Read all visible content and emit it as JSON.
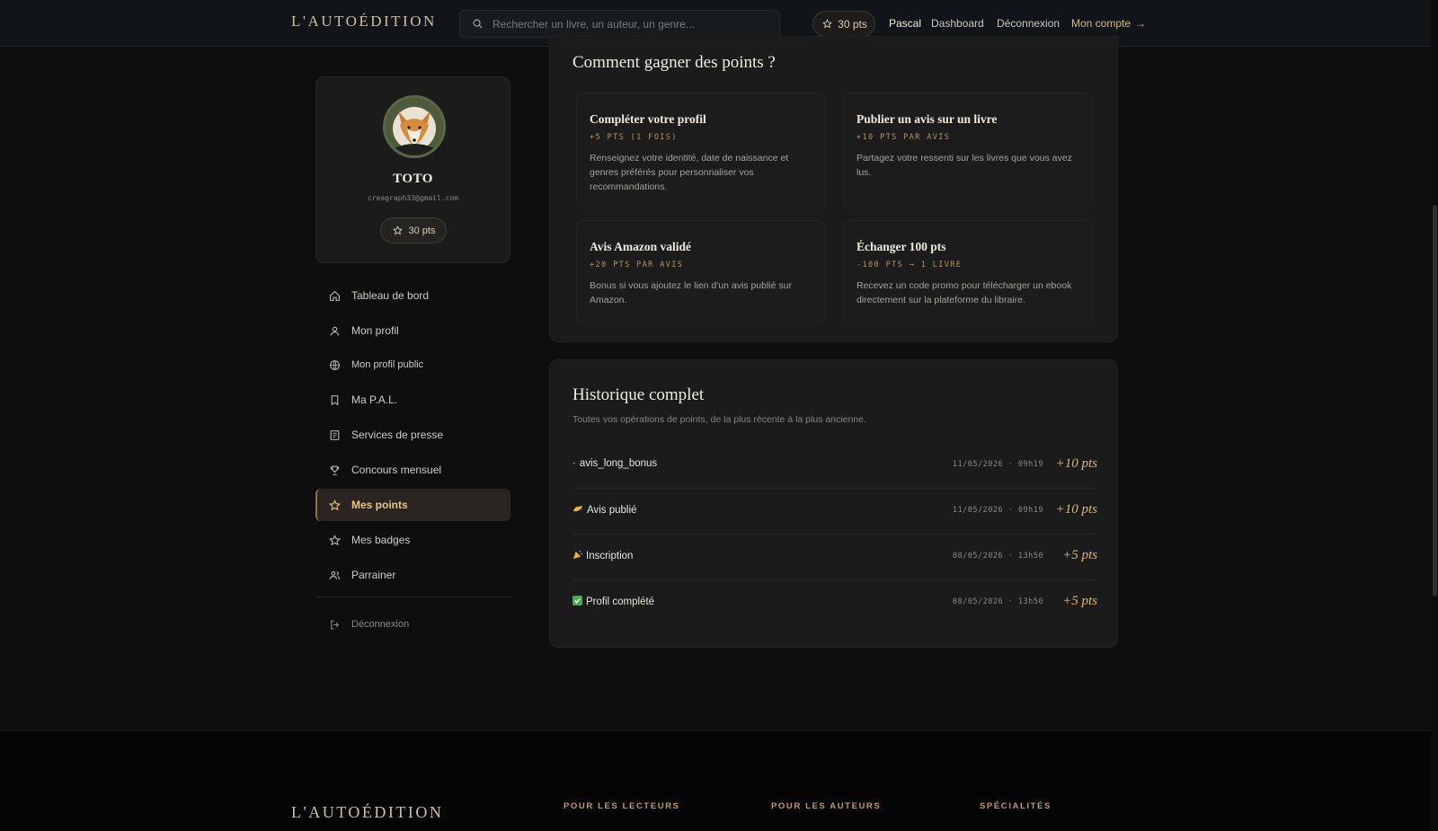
{
  "header": {
    "brand": "L'AUTOÉDITION",
    "search_placeholder": "Rechercher un livre, un auteur, un genre...",
    "points": "30 pts",
    "user": "Pascal",
    "dashboard": "Dashboard",
    "logout": "Déconnexion",
    "account": "Mon compte"
  },
  "profile": {
    "name": "TOTO",
    "email": "creagraph33@gmail.com",
    "points": "30 pts"
  },
  "sidebar": {
    "items": [
      {
        "label": "Tableau de bord",
        "icon": "home-icon"
      },
      {
        "label": "Mon profil",
        "icon": "user-icon"
      },
      {
        "label": "Mon profil public",
        "icon": "globe-icon"
      },
      {
        "label": "Ma P.A.L.",
        "icon": "bookmark-icon"
      },
      {
        "label": "Services de presse",
        "icon": "newspaper-icon"
      },
      {
        "label": "Concours mensuel",
        "icon": "trophy-icon"
      },
      {
        "label": "Mes points",
        "icon": "star-icon",
        "active": true
      },
      {
        "label": "Mes badges",
        "icon": "star-icon"
      },
      {
        "label": "Parrainer",
        "icon": "users-icon"
      }
    ],
    "logout": "Déconnexion"
  },
  "earn": {
    "title": "Comment gagner des points ?",
    "cards": [
      {
        "title": "Compléter votre profil",
        "tag": "+5 PTS (1 FOIS)",
        "desc": "Renseignez votre identité, date de naissance et genres préférés pour personnaliser vos recommandations."
      },
      {
        "title": "Publier un avis sur un livre",
        "tag": "+10 PTS PAR AVIS",
        "desc": "Partagez votre ressenti sur les livres que vous avez lus."
      },
      {
        "title": "Avis Amazon validé",
        "tag": "+20 PTS PAR AVIS",
        "desc": "Bonus si vous ajoutez le lien d'un avis publié sur Amazon."
      },
      {
        "title": "Échanger 100 pts",
        "tag": "-100 PTS → 1 LIVRE",
        "desc": "Recevez un code promo pour télécharger un ebook directement sur la plateforme du libraire."
      }
    ]
  },
  "history": {
    "title": "Historique complet",
    "subtitle": "Toutes vos opérations de points, de la plus récente à la plus ancienne.",
    "rows": [
      {
        "prefix": "·",
        "label": "avis_long_bonus",
        "date": "11/05/2026 · 09h19",
        "points": "+10 pts"
      },
      {
        "prefix": "",
        "label": "Avis publié",
        "date": "11/05/2026 · 09h19",
        "points": "+10 pts",
        "emoji": "writing-hand-icon"
      },
      {
        "prefix": "",
        "label": "Inscription",
        "date": "08/05/2026 · 13h50",
        "points": "+5 pts",
        "emoji": "party-popper-icon"
      },
      {
        "prefix": "",
        "label": "Profil complété",
        "date": "08/05/2026 · 13h50",
        "points": "+5 pts",
        "emoji": "check-mark-icon"
      }
    ]
  },
  "footer": {
    "brand": "L'AUTOÉDITION",
    "columns": [
      "POUR LES LECTEURS",
      "POUR LES AUTEURS",
      "SPÉCIALITÉS"
    ]
  },
  "colors": {
    "accent": "#d6ba86",
    "background": "#0e0e0f",
    "panel": "#1b1b1c"
  }
}
